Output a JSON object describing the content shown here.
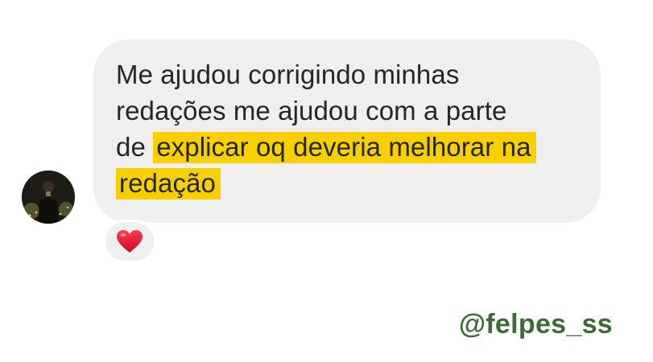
{
  "message": {
    "line1": "Me ajudou corrigindo minhas",
    "line2": "redações me ajudou com a parte",
    "line3_prefix": "de ",
    "line3_highlight": "explicar oq deveria melhorar na",
    "line4_highlight": "redação"
  },
  "reaction": {
    "icon": "heart-icon",
    "color": "#e8112d"
  },
  "highlight_color": "#f8d000",
  "username": "@felpes_ss"
}
